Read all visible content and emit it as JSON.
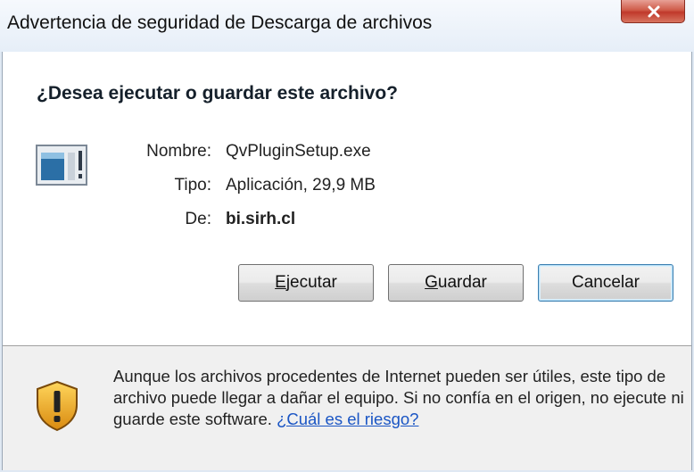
{
  "window": {
    "title": "Advertencia de seguridad de Descarga de archivos"
  },
  "dialog": {
    "question": "¿Desea ejecutar o guardar este archivo?",
    "fields": {
      "name_label": "Nombre:",
      "name_value": "QvPluginSetup.exe",
      "type_label": "Tipo:",
      "type_value": "Aplicación, 29,9 MB",
      "from_label": "De:",
      "from_value": "bi.sirh.cl"
    },
    "buttons": {
      "run": {
        "mnemonic": "E",
        "rest": "jecutar"
      },
      "save": {
        "mnemonic": "G",
        "rest": "uardar"
      },
      "cancel": "Cancelar"
    }
  },
  "footer": {
    "warning_text": "Aunque los archivos procedentes de Internet pueden ser útiles, este tipo de archivo puede llegar a dañar el equipo. Si no confía en el origen, no ejecute ni guarde este software.",
    "risk_link": "¿Cuál es el riesgo?"
  },
  "icons": {
    "close": "close-icon",
    "file": "application-file-icon",
    "warning": "warning-shield-icon"
  },
  "colors": {
    "link": "#1a55c4",
    "close_button": "#c0392b",
    "footer_bg": "#f0f0f0",
    "shield": "#e7a623"
  }
}
